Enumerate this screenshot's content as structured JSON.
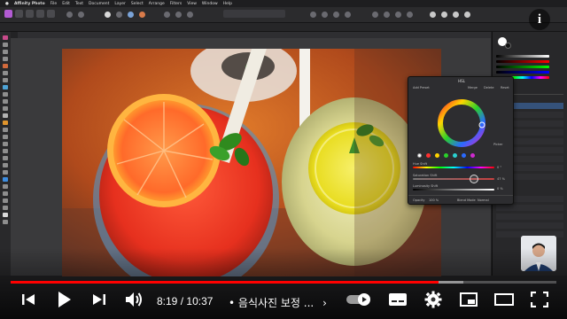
{
  "menubar": {
    "app_name": "Affinity Photo",
    "items": [
      "File",
      "Edit",
      "Text",
      "Document",
      "Layer",
      "Select",
      "Arrange",
      "Filters",
      "View",
      "Window",
      "Help"
    ]
  },
  "hsl_panel": {
    "title": "HSL",
    "presets_label": "Add Preset",
    "merge_label": "Merge",
    "delete_label": "Delete",
    "reset_label": "Reset",
    "hue_shift_label": "Hue Shift",
    "saturation_label": "Saturation Shift",
    "luminosity_label": "Luminosity Shift",
    "opacity_label": "Opacity",
    "opacity_value": "100 %",
    "blend_label": "Blend Mode",
    "blend_value": "Normal",
    "picker_label": "Picker",
    "hue_value": "0 °",
    "sat_value": "47 %",
    "lum_value": "0 %"
  },
  "player": {
    "current_time": "8:19",
    "separator": "/",
    "duration": "10:37",
    "bullet": "•",
    "chapter": "음식사진 보정 ...",
    "chapter_arrow": "›",
    "info_icon": "i",
    "progress_played": 0.784,
    "progress_buffered": 0.83,
    "accent": "#ff0000"
  },
  "icons": {
    "prev": "skip-previous-icon",
    "play": "play-icon",
    "next": "skip-next-icon",
    "volume": "volume-icon",
    "autoplay": "autoplay-toggle-icon",
    "subtitles": "subtitles-icon",
    "settings": "gear-icon",
    "miniplayer": "miniplayer-icon",
    "theater": "theater-mode-icon",
    "fullscreen": "fullscreen-icon"
  }
}
